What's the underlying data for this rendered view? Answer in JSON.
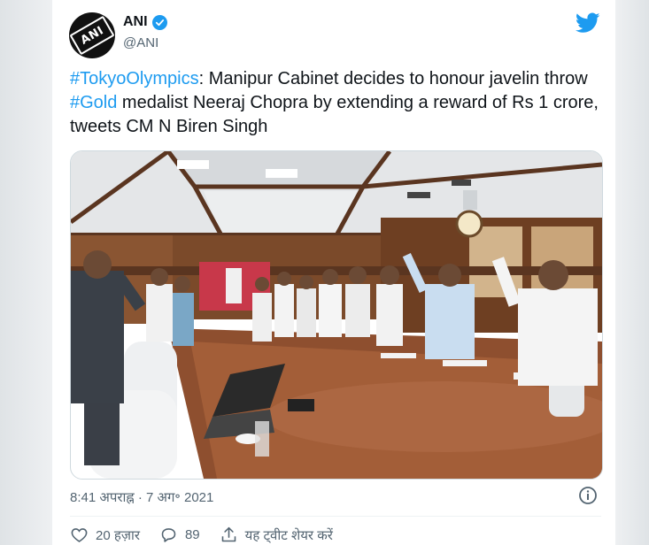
{
  "account": {
    "name": "ANI",
    "handle": "@ANI",
    "avatar_text": "ANI"
  },
  "tweet": {
    "hashtag_1": "#TokyoOlympics",
    "text_1": ": Manipur Cabinet decides to honour javelin throw ",
    "hashtag_2": "#Gold",
    "text_2": " medalist Neeraj Chopra by extending a reward of Rs 1 crore, tweets CM N Biren Singh",
    "timestamp": "8:41 अपराह्न · 7 अग॰ 2021"
  },
  "actions": {
    "like_count": "20 हज़ार",
    "reply_count": "89",
    "share_label": "यह ट्वीट शेयर करें"
  },
  "colors": {
    "accent": "#1d9bf0",
    "text": "#0f1419",
    "muted": "#536471"
  },
  "icons": [
    "verified-badge-icon",
    "twitter-bird-icon",
    "info-icon",
    "heart-icon",
    "reply-icon",
    "share-icon"
  ]
}
